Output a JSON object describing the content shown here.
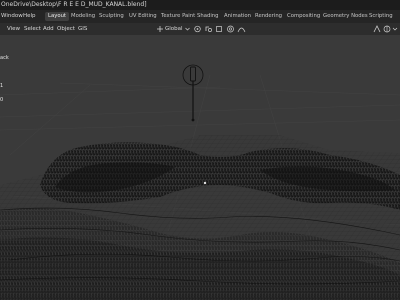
{
  "titlebar": {
    "title": "OneDrive\\Desktop\\F R E E D_MUD_KANAL.blend]"
  },
  "menubar": {
    "window_label": "Window",
    "help_label": "Help"
  },
  "workspaces": {
    "tabs": [
      {
        "label": "Layout",
        "active": true
      },
      {
        "label": "Modeling",
        "active": false
      },
      {
        "label": "Sculpting",
        "active": false
      },
      {
        "label": "UV Editing",
        "active": false
      },
      {
        "label": "Texture Paint",
        "active": false
      },
      {
        "label": "Shading",
        "active": false
      },
      {
        "label": "Animation",
        "active": false
      },
      {
        "label": "Rendering",
        "active": false
      },
      {
        "label": "Compositing",
        "active": false
      },
      {
        "label": "Geometry Nodes",
        "active": false
      },
      {
        "label": "Scripting",
        "active": false
      }
    ]
  },
  "header": {
    "view_label": "View",
    "select_label": "Select",
    "add_label": "Add",
    "object_label": "Object",
    "gis_label": "GIS",
    "orientation_label": "Global"
  },
  "viewport": {
    "side_labels": [
      "ack",
      "1",
      "0"
    ]
  },
  "colors": {
    "active_tab": "#3f3f3f",
    "background": "#3a3a3a",
    "mesh": "#101010"
  }
}
